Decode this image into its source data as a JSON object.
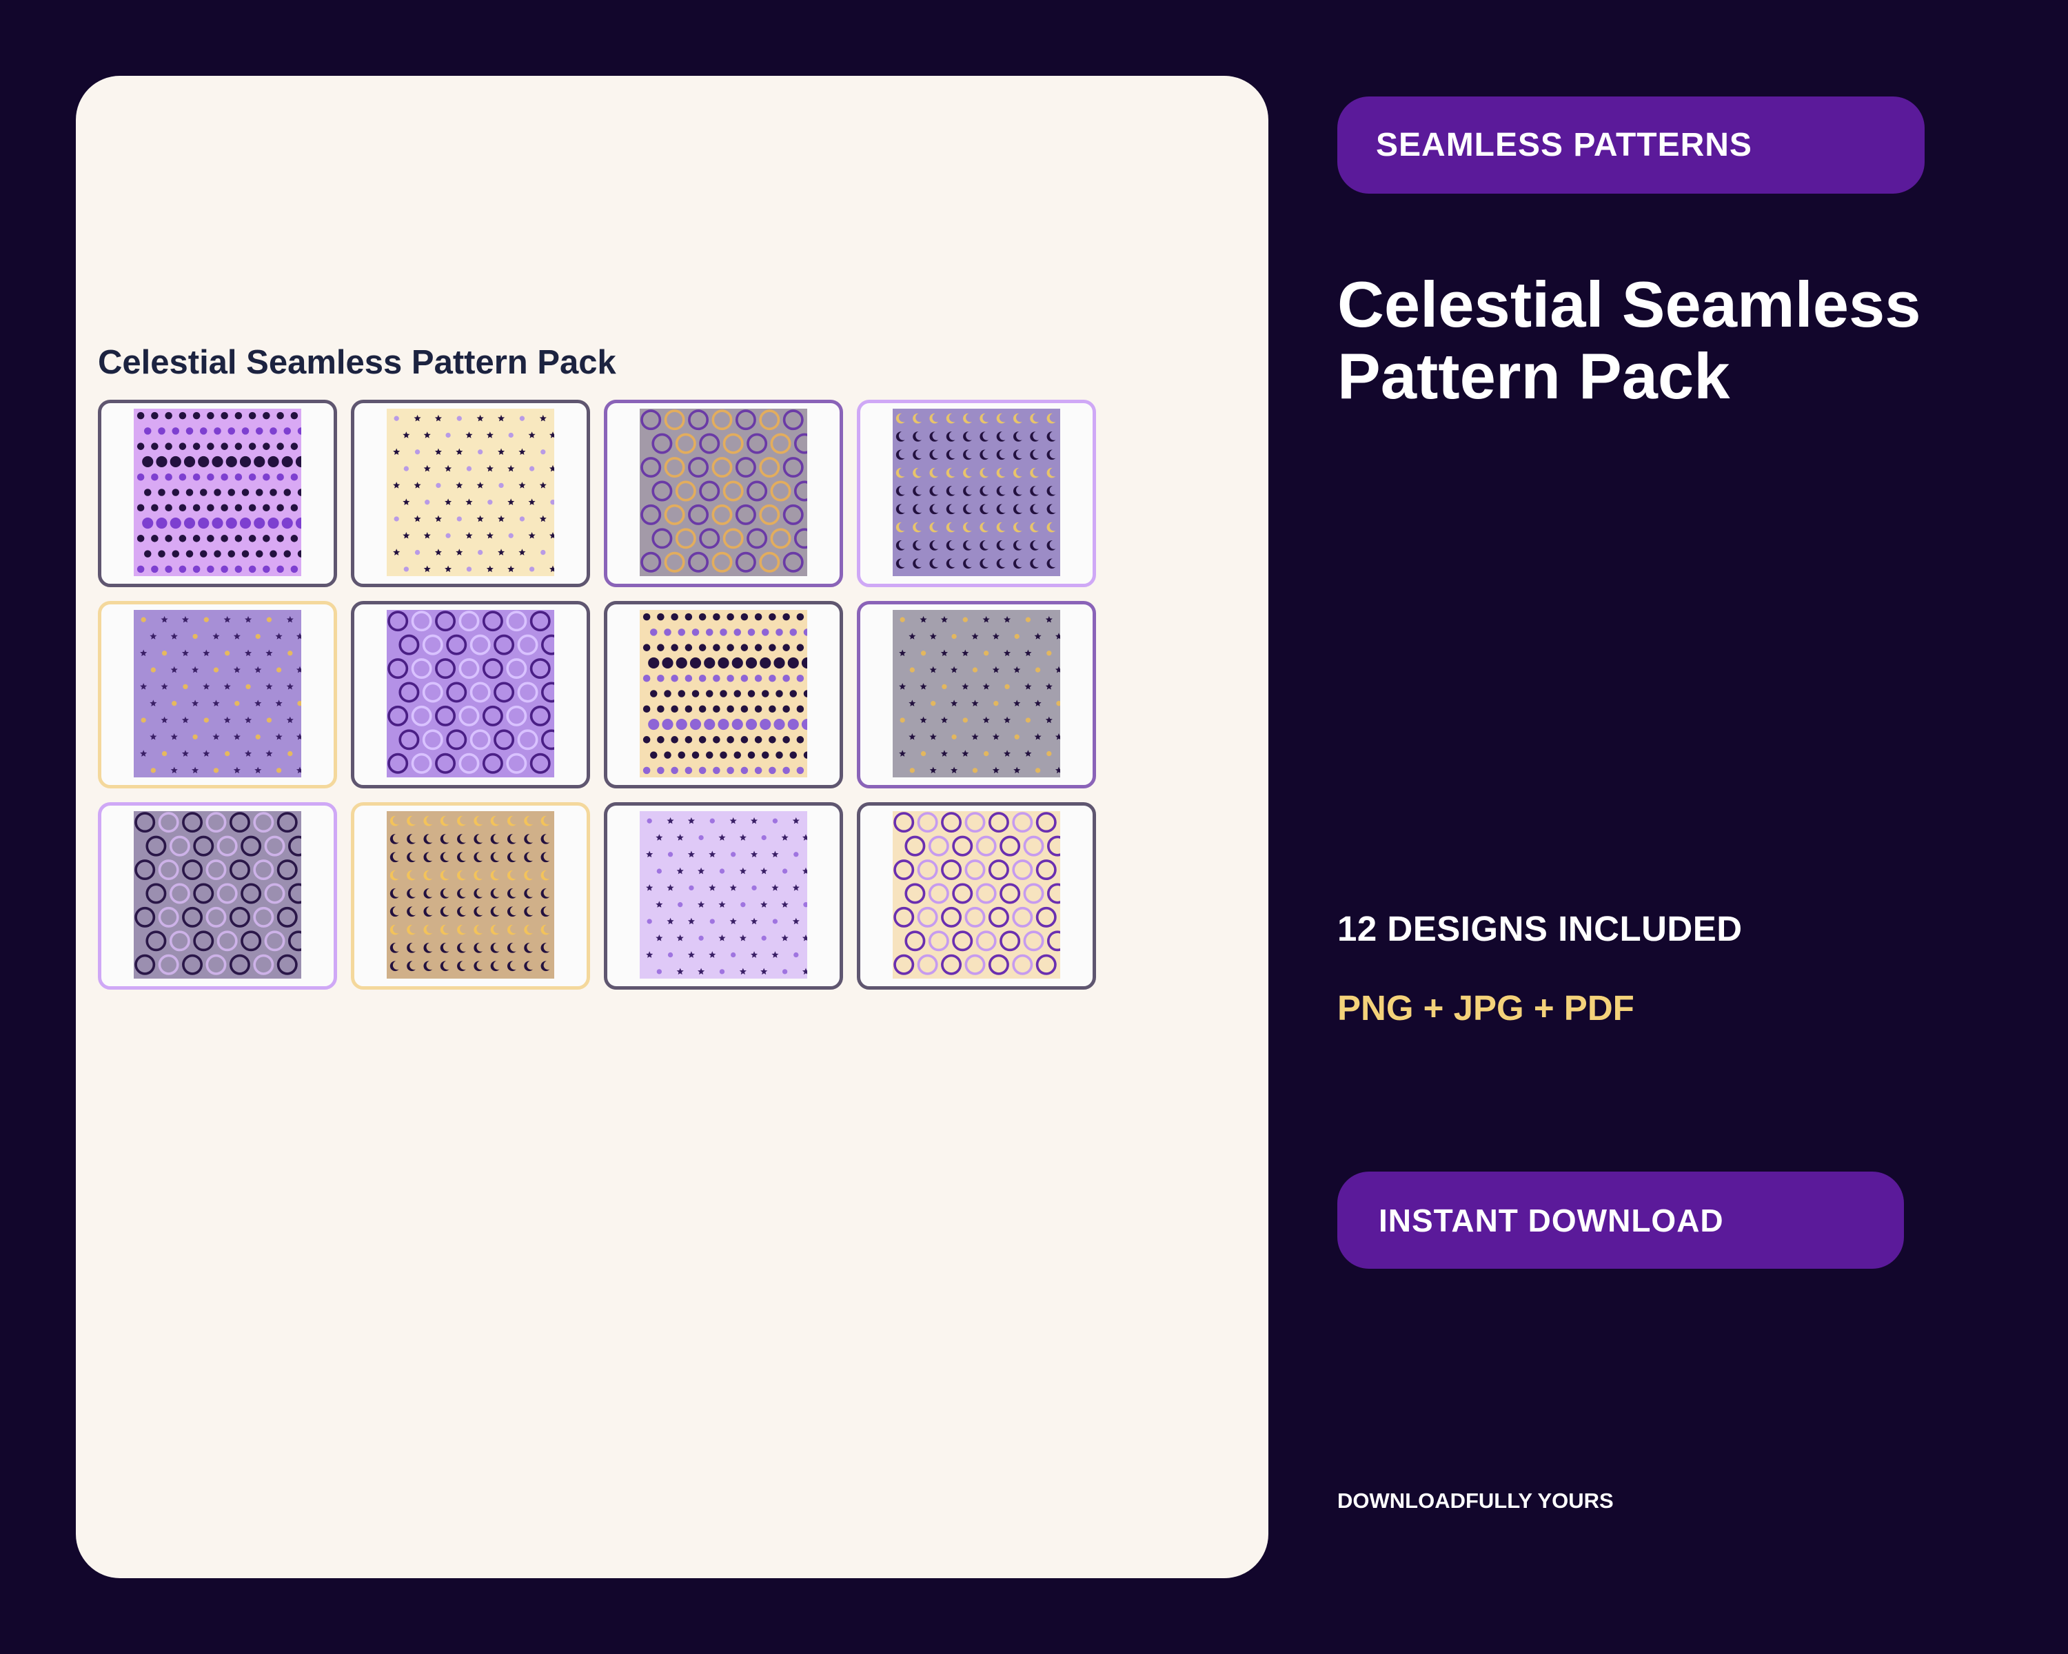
{
  "card": {
    "title": "Celestial Seamless Pattern Pack"
  },
  "patterns": [
    {
      "name": "dots-rows",
      "style": "dots",
      "bg": "#d9a9f4",
      "fg": "#23113f",
      "accent": "#7d3fd0",
      "border": "#5f5670"
    },
    {
      "name": "tiny-stars",
      "style": "stars",
      "bg": "#f8e8bf",
      "fg": "#23113f",
      "accent": "#b89ae6",
      "border": "#5f5670"
    },
    {
      "name": "rings",
      "style": "rings",
      "bg": "#a39aa8",
      "fg": "#6a3aa6",
      "accent": "#e3ad5d",
      "border": "#8a63b8"
    },
    {
      "name": "moon-phases",
      "style": "moons",
      "bg": "#9c8cc6",
      "fg": "#23113f",
      "accent": "#e8c46a",
      "border": "#cfa8f6"
    },
    {
      "name": "lavender-stars",
      "style": "stars",
      "bg": "#a78fd6",
      "fg": "#3a1f66",
      "accent": "#e6b95e",
      "border": "#f4d89c"
    },
    {
      "name": "purple-rings",
      "style": "rings",
      "bg": "#b491e6",
      "fg": "#4a1f85",
      "accent": "#d9c2ff",
      "border": "#5f5670"
    },
    {
      "name": "cream-dots",
      "style": "dots",
      "bg": "#f6dfb3",
      "fg": "#23113f",
      "accent": "#8e64d6",
      "border": "#5f5670"
    },
    {
      "name": "grey-stars",
      "style": "stars",
      "bg": "#a4a0ad",
      "fg": "#23113f",
      "accent": "#e3b75e",
      "border": "#8a63b8"
    },
    {
      "name": "dark-rings",
      "style": "rings",
      "bg": "#9b8fb0",
      "fg": "#2a1748",
      "accent": "#cdb2e8",
      "border": "#cfa8f6"
    },
    {
      "name": "gold-moons",
      "style": "moons",
      "bg": "#d0b089",
      "fg": "#23113f",
      "accent": "#f3c35a",
      "border": "#f4d89c"
    },
    {
      "name": "lilac-stars",
      "style": "stars",
      "bg": "#dfc9f7",
      "fg": "#3a1f66",
      "accent": "#9f74e0",
      "border": "#5f5670"
    },
    {
      "name": "cream-rings",
      "style": "rings",
      "bg": "#f7e3bf",
      "fg": "#6a2fb0",
      "accent": "#c69bef",
      "border": "#5f5670"
    }
  ],
  "sidebar": {
    "tag": "SEAMLESS PATTERNS",
    "headline": "Celestial Seamless Pattern Pack",
    "designs_count": "12 DESIGNS INCLUDED",
    "formats": "PNG + JPG + PDF",
    "cta": "INSTANT DOWNLOAD",
    "brand": "DOWNLOADFULLY YOURS"
  },
  "colors": {
    "background": "#12062c",
    "card": "#faf5ef",
    "pill": "#5b1a9a",
    "formats_accent": "#f4d27a",
    "card_title": "#1c2340"
  }
}
